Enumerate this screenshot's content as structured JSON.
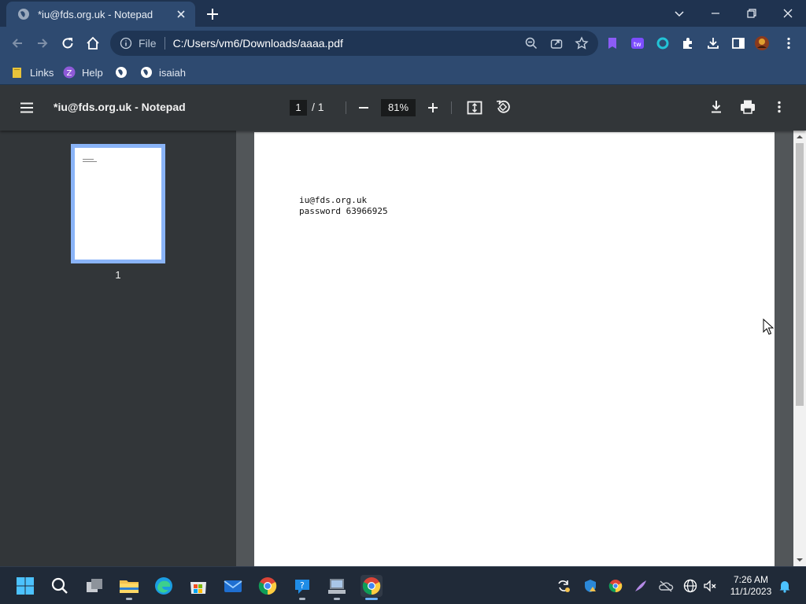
{
  "browser": {
    "tab": {
      "title": "*iu@fds.org.uk - Notepad"
    },
    "address": {
      "scheme": "File",
      "url": "C:/Users/vm6/Downloads/aaaa.pdf"
    },
    "bookmarks": [
      {
        "label": "Links"
      },
      {
        "label": "Help"
      },
      {
        "label": ""
      },
      {
        "label": "isaiah"
      }
    ]
  },
  "pdf": {
    "title": "*iu@fds.org.uk - Notepad",
    "current_page": "1",
    "page_count": "/  1",
    "zoom": "81%",
    "thumbnail_label": "1",
    "content": {
      "line1": "iu@fds.org.uk",
      "line2": "password 63966925"
    }
  },
  "taskbar": {
    "time": "7:26 AM",
    "date": "11/1/2023"
  },
  "colors": {
    "chrome_dark": "#1f3350",
    "chrome_toolbar": "#2e4a70",
    "pdf_toolbar": "#323639",
    "pdf_background": "#525659",
    "thumbnail_highlight": "#8ab4f8",
    "taskbar": "#202a38"
  }
}
